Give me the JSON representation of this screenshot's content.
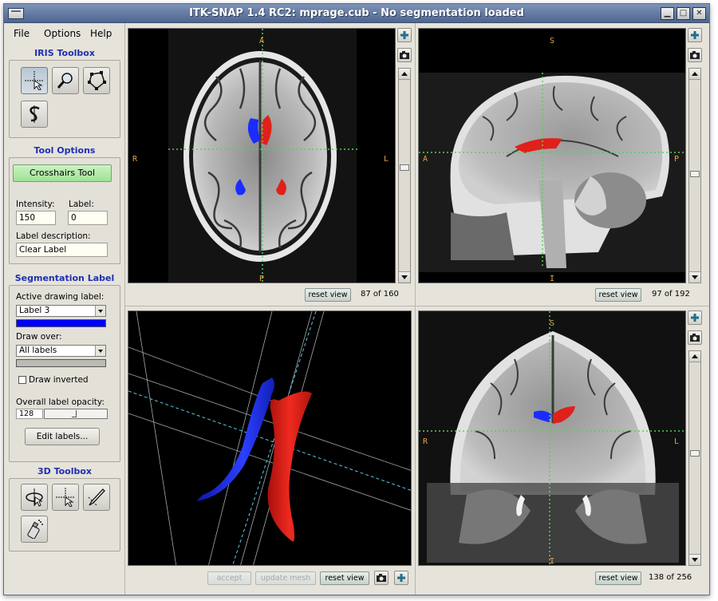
{
  "window": {
    "title": "ITK-SNAP 1.4 RC2: mprage.cub - No segmentation loaded"
  },
  "menu": {
    "file": "File",
    "options": "Options",
    "help": "Help"
  },
  "iris_toolbox": {
    "title": "IRIS Toolbox"
  },
  "tool_options": {
    "title": "Tool Options",
    "active_tool": "Crosshairs Tool",
    "intensity_label": "Intensity:",
    "intensity_value": "150",
    "label_label": "Label:",
    "label_value": "0",
    "label_description_label": "Label description:",
    "label_description_value": "Clear Label"
  },
  "segmentation_label": {
    "title": "Segmentation Label",
    "active_drawing_label": "Active drawing label:",
    "active_value": "Label 3",
    "active_color": "#0000ff",
    "draw_over_label": "Draw over:",
    "draw_over_value": "All labels",
    "draw_inverted_label": "Draw inverted",
    "opacity_label": "Overall label opacity:",
    "opacity_value": "128",
    "edit_labels_button": "Edit labels..."
  },
  "toolbox_3d": {
    "title": "3D Toolbox"
  },
  "views": {
    "axial": {
      "top": "A",
      "bottom": "P",
      "left": "R",
      "right": "L",
      "reset": "reset view",
      "slice": "87 of 160"
    },
    "sagittal": {
      "top": "S",
      "bottom": "I",
      "left": "A",
      "right": "P",
      "reset": "reset view",
      "slice": "97 of 192"
    },
    "coronal": {
      "top": "S",
      "bottom": "I",
      "left": "R",
      "right": "L",
      "reset": "reset view",
      "slice": "138 of 256"
    },
    "render3d": {
      "accept": "accept",
      "update_mesh": "update mesh",
      "reset": "reset view"
    }
  },
  "colors": {
    "crosshair": "#4fd54f",
    "label_blue": "#1a2cff",
    "label_red": "#e0201a",
    "orientation_text": "#e8a34a"
  }
}
